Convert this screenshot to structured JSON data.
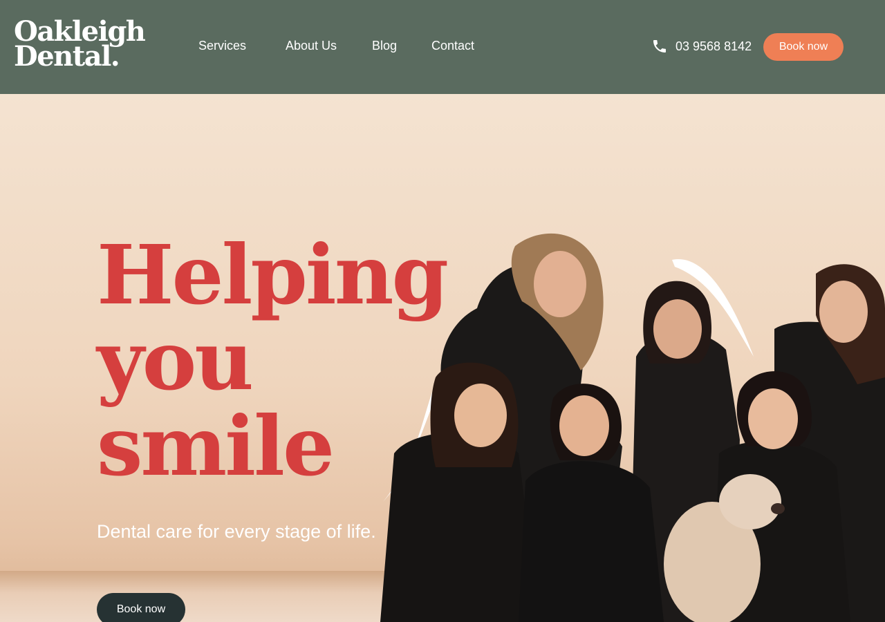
{
  "brand": {
    "logo_line1": "Oakleigh",
    "logo_line2": "Dental."
  },
  "nav": {
    "items": [
      {
        "label": "Services"
      },
      {
        "label": "About Us"
      },
      {
        "label": "Blog"
      },
      {
        "label": "Contact"
      }
    ]
  },
  "header": {
    "phone": "03 9568 8142",
    "phone_icon": "phone-icon",
    "book_label": "Book now"
  },
  "hero": {
    "headline_line1": "Helping",
    "headline_line2": "you",
    "headline_line3": "smile",
    "subhead": "Dental care for every stage of life.",
    "book_label": "Book now",
    "photo_alt": "Oakleigh Dental team with dog"
  },
  "colors": {
    "header_bg": "#5a6b5f",
    "accent_orange": "#ef7f55",
    "headline_red": "#d53f3e",
    "dark_button": "#263233",
    "hero_bg": "#efd6bf"
  }
}
